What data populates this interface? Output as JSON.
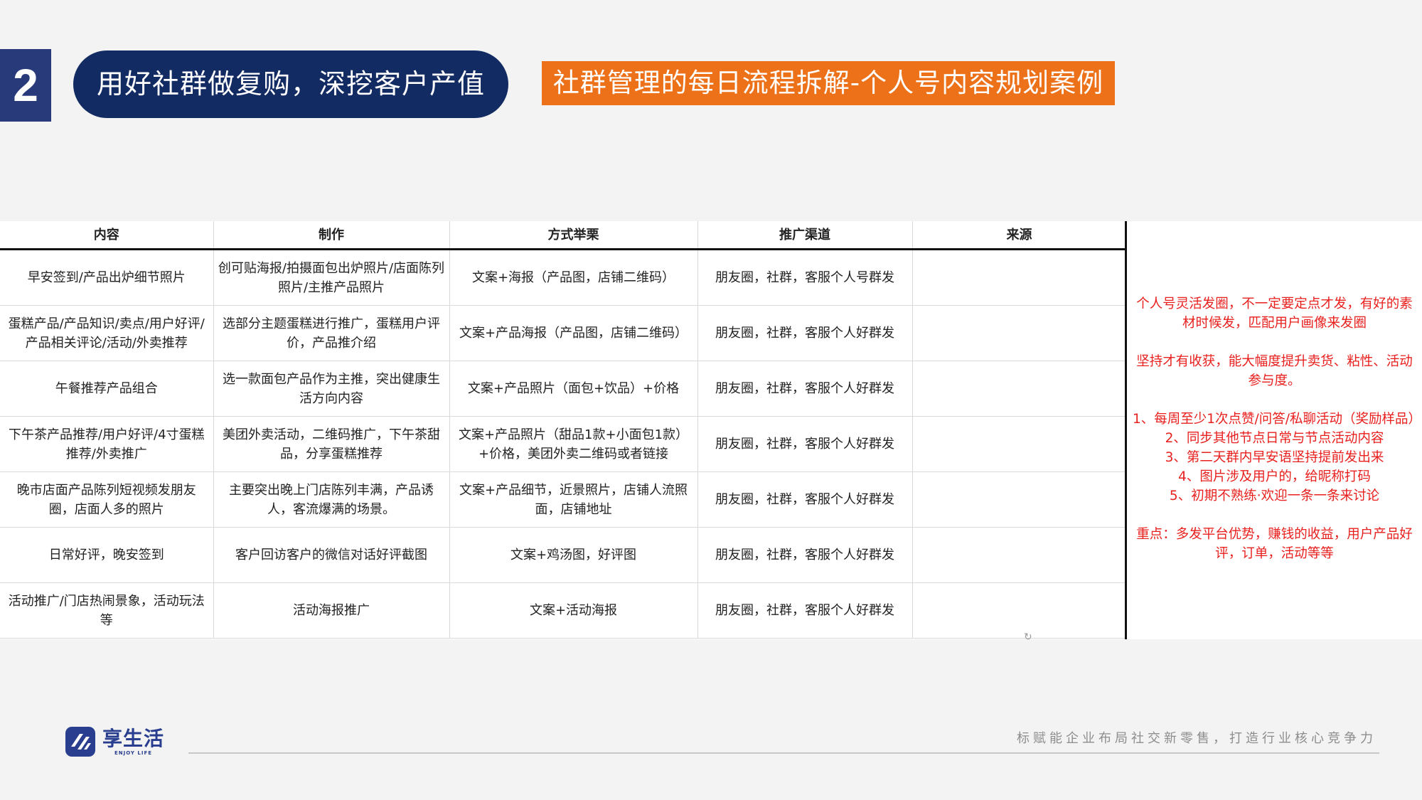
{
  "header": {
    "section_number": "2",
    "section_title": "用好社群做复购，深挖客户产值",
    "case_title": "社群管理的每日流程拆解-个人号内容规划案例"
  },
  "table": {
    "columns": [
      "内容",
      "制作",
      "方式举栗",
      "推广渠道",
      "来源"
    ],
    "rows": [
      {
        "content": "早安签到/产品出炉细节照片",
        "production": "创可贴海报/拍摄面包出炉照片/店面陈列照片/主推产品照片",
        "method": "文案+海报（产品图，店铺二维码）",
        "channel": "朋友圈，社群，客服个人号群发",
        "source": ""
      },
      {
        "content": "蛋糕产品/产品知识/卖点/用户好评/产品相关评论/活动/外卖推荐",
        "production": "选部分主题蛋糕进行推广，蛋糕用户评价，产品推介绍",
        "method": "文案+产品海报（产品图，店铺二维码）",
        "channel": "朋友圈，社群，客服个人好群发",
        "source": ""
      },
      {
        "content": "午餐推荐产品组合",
        "production": "选一款面包产品作为主推，突出健康生活方向内容",
        "method": "文案+产品照片（面包+饮品）+价格",
        "channel": "朋友圈，社群，客服个人好群发",
        "source": ""
      },
      {
        "content": "下午茶产品推荐/用户好评/4寸蛋糕推荐/外卖推广",
        "production": "美团外卖活动，二维码推广，下午茶甜品，分享蛋糕推荐",
        "method": "文案+产品照片（甜品1款+小面包1款）+价格，美团外卖二维码或者链接",
        "channel": "朋友圈，社群，客服个人好群发",
        "source": ""
      },
      {
        "content": "晚市店面产品陈列短视频发朋友圈，店面人多的照片",
        "production": "主要突出晚上门店陈列丰满，产品诱人，客流爆满的场景。",
        "method": "文案+产品细节，近景照片，店铺人流照面，店铺地址",
        "channel": "朋友圈，社群，客服个人好群发",
        "source": ""
      },
      {
        "content": "日常好评，晚安签到",
        "production": "客户回访客户的微信对话好评截图",
        "method": "文案+鸡汤图，好评图",
        "channel": "朋友圈，社群，客服个人好群发",
        "source": ""
      },
      {
        "content": "活动推广/门店热闹景象，活动玩法等",
        "production": "活动海报推广",
        "method": "文案+活动海报",
        "channel": "朋友圈，社群，客服个人好群发",
        "source": ""
      }
    ]
  },
  "side_note": {
    "para1": "个人号灵活发圈，不一定要定点才发，有好的素材时候发，匹配用户画像来发圈",
    "para2": "坚持才有收获，能大幅度提升卖货、粘性、活动参与度。",
    "list": [
      "1、每周至少1次点赞/问答/私聊活动（奖励样品）",
      "2、同步其他节点日常与节点活动内容",
      "3、第二天群内早安语坚持提前发出来",
      "4、图片涉及用户的，给昵称打码",
      "5、初期不熟练·欢迎一条一条来讨论"
    ],
    "para3": "重点：多发平台优势，赚钱的收益，用户产品好评，订单，活动等等"
  },
  "footer": {
    "logo_cn": "享生活",
    "logo_en": "ENJOY LIFE",
    "tagline": "标赋能企业布局社交新零售，打造行业核心竞争力"
  },
  "colors": {
    "section_num_bg": "#283a7a",
    "section_title_bg": "#132b63",
    "case_title_bg": "#ec7119",
    "note_red": "#e8201e",
    "brand_blue": "#2a3e8f"
  }
}
